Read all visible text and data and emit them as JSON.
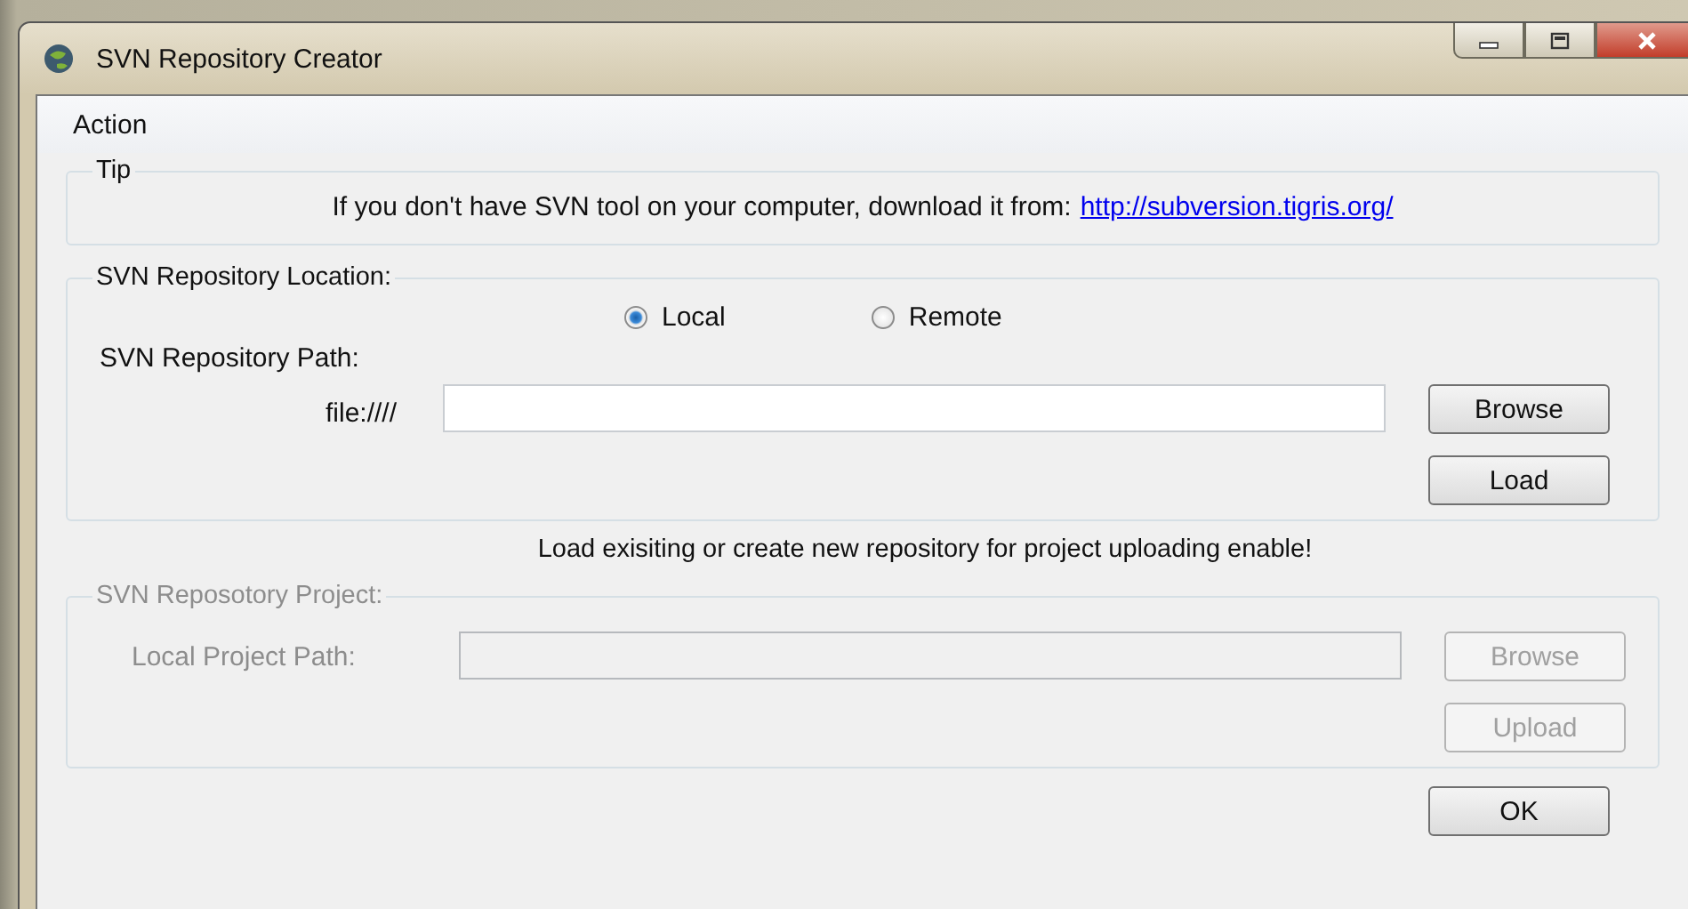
{
  "window": {
    "title": "SVN Repository Creator"
  },
  "menu": [
    {
      "label": "Action"
    }
  ],
  "tip": {
    "title": "Tip",
    "text": "If you don't have SVN tool on your computer, download it from:",
    "link": "http://subversion.tigris.org/"
  },
  "location": {
    "title": "SVN Repository Location:",
    "options": [
      {
        "label": "Local",
        "selected": true
      },
      {
        "label": "Remote",
        "selected": false
      }
    ],
    "path_label": "SVN Repository Path:",
    "prefix": "file:////",
    "buttons": [
      {
        "label": "Browse",
        "disabled": false
      },
      {
        "label": "Load",
        "disabled": false
      }
    ]
  },
  "message": "Load exisiting or create new repository for project uploading enable!",
  "project": {
    "title": "SVN Reposotory Project:",
    "disabled": true,
    "path_label": "Local Project Path:",
    "buttons": [
      {
        "label": "Browse",
        "disabled": true
      },
      {
        "label": "Upload",
        "disabled": true
      }
    ]
  },
  "ok_button": {
    "label": "OK",
    "disabled": false
  }
}
